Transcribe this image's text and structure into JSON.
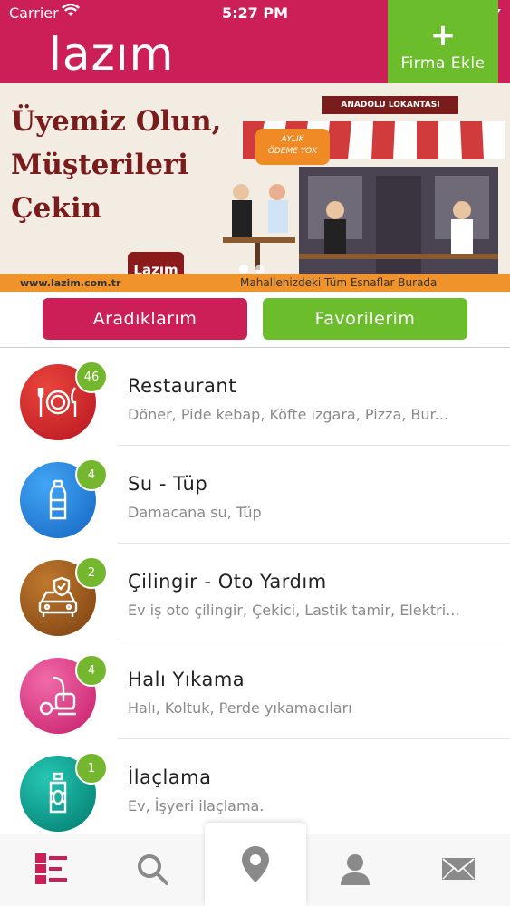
{
  "status_bar": {
    "carrier": "Carrier",
    "time": "5:27 PM"
  },
  "header": {
    "logo": "lazım",
    "add_firm_icon": "plus-icon",
    "add_firm_label": "Firma Ekle",
    "brand_color": "#cc1f57",
    "accent_color": "#6cbd2c"
  },
  "banner": {
    "headline_line1": "Üyemiz Olun,",
    "headline_line2": "Müşterileri",
    "headline_line3": "Çekin",
    "restaurant_sign": "ANADOLU LOKANTASI",
    "tag_line1": "AYLIK",
    "tag_line2": "ÖDEME YOK",
    "badge": "Lazım",
    "url": "www.lazim.com.tr",
    "slogan": "Mahallenizdeki Tüm Esnaflar Burada"
  },
  "tabs": {
    "searches_label": "Aradıklarım",
    "favorites_label": "Favorilerim"
  },
  "categories": [
    {
      "title": "Restaurant",
      "subtitle": "Döner, Pide kebap, Köfte ızgara, Pizza, Bur...",
      "count": "46",
      "icon": "plate-cutlery-icon",
      "color": "#d02030"
    },
    {
      "title": "Su - Tüp",
      "subtitle": "Damacana su, Tüp",
      "count": "4",
      "icon": "water-bottle-icon",
      "color": "#1e88e5"
    },
    {
      "title": "Çilingir - Oto Yardım",
      "subtitle": "Ev iş oto çilingir, Çekici, Lastik tamir, Elektri...",
      "count": "2",
      "icon": "car-shield-icon",
      "color": "#9a5a1e"
    },
    {
      "title": "Halı Yıkama",
      "subtitle": "Halı, Koltuk, Perde yıkamacıları",
      "count": "4",
      "icon": "vacuum-cleaner-icon",
      "color": "#e0357e"
    },
    {
      "title": "İlaçlama",
      "subtitle": "Ev, İşyeri ilaçlama.",
      "count": "1",
      "icon": "spray-bug-icon",
      "color": "#00a69a"
    }
  ],
  "bottom_nav": [
    {
      "icon": "list-icon",
      "active": true
    },
    {
      "icon": "search-icon",
      "active": false
    },
    {
      "icon": "location-pin-icon",
      "active": false
    },
    {
      "icon": "user-icon",
      "active": false
    },
    {
      "icon": "mail-icon",
      "active": false
    }
  ]
}
